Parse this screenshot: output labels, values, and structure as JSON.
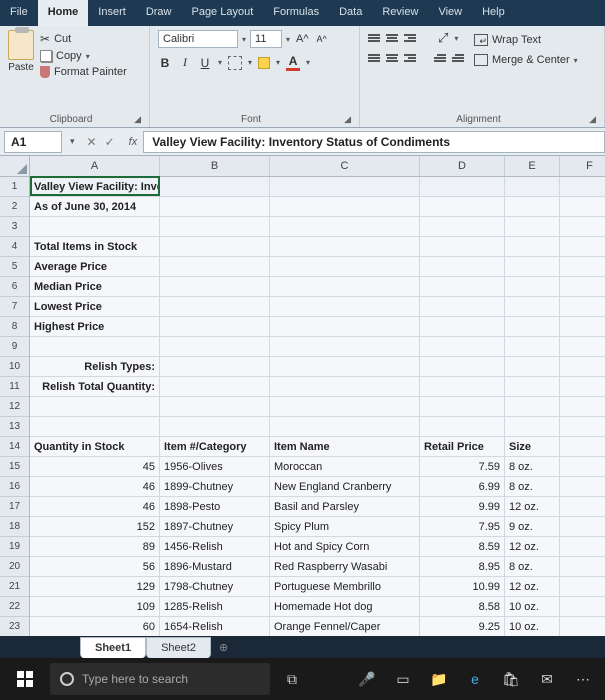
{
  "tabs": {
    "file": "File",
    "home": "Home",
    "insert": "Insert",
    "draw": "Draw",
    "pagelayout": "Page Layout",
    "formulas": "Formulas",
    "data": "Data",
    "review": "Review",
    "view": "View",
    "help": "Help"
  },
  "clipboard": {
    "paste": "Paste",
    "cut": "Cut",
    "copy": "Copy",
    "formatpainter": "Format Painter",
    "group": "Clipboard"
  },
  "font": {
    "name": "Calibri",
    "size": "11",
    "group": "Font"
  },
  "alignment": {
    "wrap": "Wrap Text",
    "merge": "Merge & Center",
    "group": "Alignment"
  },
  "namebox": "A1",
  "formula": "Valley View Facility: Inventory Status of Condiments",
  "cols": {
    "a": "A",
    "b": "B",
    "c": "C",
    "d": "D",
    "e": "E",
    "f": "F"
  },
  "labels": {
    "title": "Valley View Facility: Inventory Status of Condiments",
    "asof": "As of June 30, 2014",
    "totalitems": "Total Items in Stock",
    "avgprice": "Average Price",
    "medprice": "Median Price",
    "lowprice": "Lowest Price",
    "highprice": "Highest Price",
    "relishtypes": "Relish Types:",
    "relishtotal": "Relish Total Quantity:",
    "qtyhdr": "Quantity in Stock",
    "itemhdr": "Item #/Category",
    "namehdr": "Item Name",
    "pricehdr": "Retail Price",
    "sizehdr": "Size"
  },
  "rows": [
    {
      "qty": "45",
      "item": "1956-Olives",
      "name": "Moroccan",
      "price": "7.59",
      "size": "8 oz."
    },
    {
      "qty": "46",
      "item": "1899-Chutney",
      "name": "New England Cranberry",
      "price": "6.99",
      "size": "8 oz."
    },
    {
      "qty": "46",
      "item": "1898-Pesto",
      "name": "Basil and Parsley",
      "price": "9.99",
      "size": "12 oz."
    },
    {
      "qty": "152",
      "item": "1897-Chutney",
      "name": "Spicy Plum",
      "price": "7.95",
      "size": "9 oz."
    },
    {
      "qty": "89",
      "item": "1456-Relish",
      "name": "Hot and Spicy Corn",
      "price": "8.59",
      "size": "12 oz."
    },
    {
      "qty": "56",
      "item": "1896-Mustard",
      "name": "Red Raspberry Wasabi",
      "price": "8.95",
      "size": "8 oz."
    },
    {
      "qty": "129",
      "item": "1798-Chutney",
      "name": "Portuguese Membrillo",
      "price": "10.99",
      "size": "12 oz."
    },
    {
      "qty": "109",
      "item": "1285-Relish",
      "name": "Homemade Hot dog",
      "price": "8.58",
      "size": "10 oz."
    },
    {
      "qty": "60",
      "item": "1654-Relish",
      "name": "Orange Fennel/Caper",
      "price": "9.25",
      "size": "10 oz."
    }
  ],
  "sheets": {
    "s1": "Sheet1",
    "s2": "Sheet2"
  },
  "taskbar": {
    "search_placeholder": "Type here to search"
  }
}
